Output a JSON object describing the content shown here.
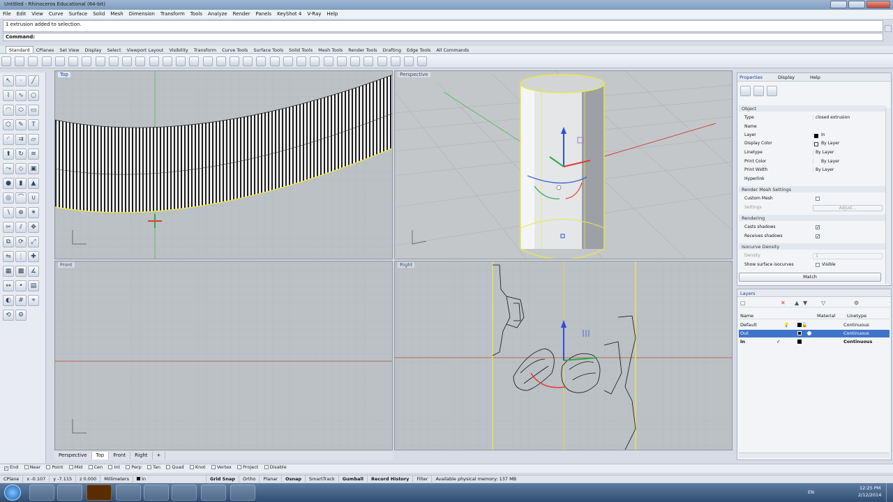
{
  "window": {
    "title": "Untitled - Rhinoceros Educational (64-bit)"
  },
  "menu": [
    "File",
    "Edit",
    "View",
    "Curve",
    "Surface",
    "Solid",
    "Mesh",
    "Dimension",
    "Transform",
    "Tools",
    "Analyze",
    "Render",
    "Panels",
    "KeyShot 4",
    "V-Ray",
    "Help"
  ],
  "history": {
    "line": "1 extrusion added to selection."
  },
  "command": {
    "label": "Command:"
  },
  "toolbar_tabs": [
    "Standard",
    "CPlanes",
    "Set View",
    "Display",
    "Select",
    "Viewport Layout",
    "Visibility",
    "Transform",
    "Curve Tools",
    "Surface Tools",
    "Solid Tools",
    "Mesh Tools",
    "Render Tools",
    "Drafting",
    "Edge Tools",
    "All Commands"
  ],
  "viewports": {
    "top": "Top",
    "perspective": "Perspective",
    "front": "Front",
    "right": "Right"
  },
  "viewport_tabs": [
    "Perspective",
    "Top",
    "Front",
    "Right"
  ],
  "properties": {
    "tabs": [
      "Properties",
      "Display",
      "Help"
    ],
    "section_object": "Object",
    "rows": [
      {
        "k": "Type",
        "v": "closed extrusion"
      },
      {
        "k": "Name",
        "v": ""
      },
      {
        "k": "Layer",
        "v": "In"
      },
      {
        "k": "Display Color",
        "v": "By Layer"
      },
      {
        "k": "Linetype",
        "v": "By Layer"
      },
      {
        "k": "Print Color",
        "v": "By Layer"
      },
      {
        "k": "Print Width",
        "v": "By Layer"
      },
      {
        "k": "Hyperlink",
        "v": ""
      }
    ],
    "section_mesh": "Render Mesh Settings",
    "custom_mesh": "Custom Mesh",
    "settings": "Settings",
    "adjust": "Adjust...",
    "section_rendering": "Rendering",
    "casts": "Casts shadows",
    "receives": "Receives shadows",
    "section_iso": "Isocurve Density",
    "density": "Density",
    "show_iso": "Show surface isocurves",
    "visible": "Visible",
    "match": "Match"
  },
  "layers": {
    "title": "Layers",
    "cols": [
      "Name",
      "Material",
      "Linetype"
    ],
    "rows": [
      {
        "name": "Default",
        "linetype": "Continuous"
      },
      {
        "name": "Out",
        "linetype": "Continuous"
      },
      {
        "name": "In",
        "linetype": "Continuous"
      }
    ]
  },
  "osnaps": [
    "End",
    "Near",
    "Point",
    "Mid",
    "Cen",
    "Int",
    "Perp",
    "Tan",
    "Quad",
    "Knot",
    "Vertex",
    "Project",
    "Disable"
  ],
  "status": {
    "cplane": "CPlane",
    "x": "x -0.107",
    "y": "y -7.115",
    "z": "z 0.000",
    "units": "Millimeters",
    "layer": "In",
    "grid_snap": "Grid Snap",
    "ortho": "Ortho",
    "planar": "Planar",
    "osnap": "Osnap",
    "smarttrack": "SmartTrack",
    "gumball": "Gumball",
    "record_history": "Record History",
    "filter": "Filter",
    "memory": "Available physical memory: 137 MB"
  },
  "taskbar": {
    "lang": "EN",
    "time": "12:25 PM",
    "date": "2/12/2014"
  },
  "colors": {
    "accent": "#3e74c9",
    "selection": "#e8e84a",
    "gumball_red": "#e03a2a",
    "gumball_green": "#2ea84a",
    "gumball_blue": "#2c4fd6"
  }
}
